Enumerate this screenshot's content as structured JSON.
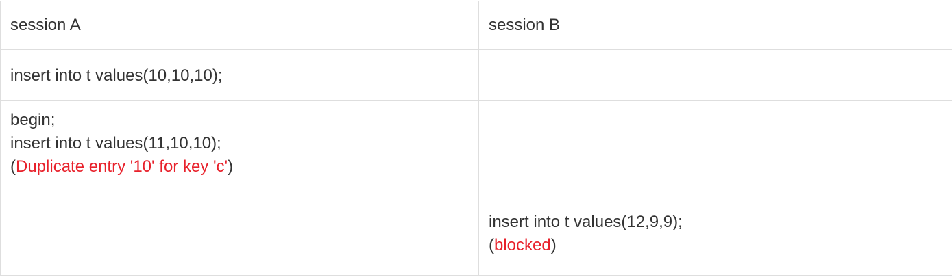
{
  "header": {
    "col_a": "session A",
    "col_b": "session B"
  },
  "rows": [
    {
      "a": {
        "line1": "insert into t values(10,10,10);"
      }
    },
    {
      "a": {
        "line1": "begin;",
        "line2": "insert into t values(11,10,10);",
        "line3_open": "(",
        "line3_error": "Duplicate entry '10' for key 'c'",
        "line3_close": ")"
      }
    },
    {
      "b": {
        "line1": "insert into t values(12,9,9);",
        "line2_open": "(",
        "line2_error": "blocked",
        "line2_close": ")"
      }
    }
  ],
  "colors": {
    "text": "#333333",
    "error": "#e8212b",
    "border": "#dedede"
  }
}
